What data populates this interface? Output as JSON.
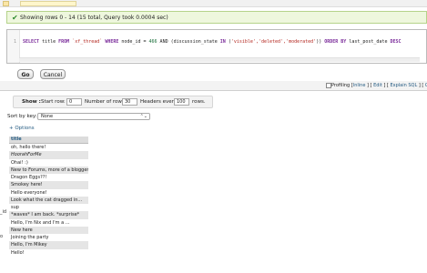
{
  "success": {
    "message": "Showing rows 0 - 14 (15 total, Query took 0.0004 sec)",
    "check_glyph": "✔"
  },
  "sql": {
    "line_number": "1",
    "tokens": {
      "t1": "SELECT",
      "t2": " title ",
      "t3": "FROM",
      "t4": " `xf_thread` ",
      "t5": "WHERE",
      "t6": " node_id = ",
      "t7": "466",
      "t8": " AND (discussion_state ",
      "t9": "IN",
      "t10": " (",
      "t11": "'visible','deleted','moderated'",
      "t12": ")) ",
      "t13": "ORDER BY",
      "t14": " last_post_date ",
      "t15": "DESC"
    }
  },
  "buttons": {
    "go": "Go",
    "cancel": "Cancel"
  },
  "profiling": {
    "label": "Profiling [",
    "inline": "Inline",
    "sep1": " ] [ ",
    "edit": "Edit",
    "sep2": " ] [ ",
    "explain": "Explain SQL",
    "sep3": " ] [ ",
    "create": "Cr"
  },
  "nav": {
    "show_label": "Show :",
    "start_row_label": "Start row:",
    "start_row_value": "0",
    "num_rows_label": "Number of rows:",
    "num_rows_value": "30",
    "headers_every_label": "Headers every",
    "headers_every_value": "100",
    "rows_label": "rows."
  },
  "sort": {
    "label": "Sort by key:",
    "selected": "None",
    "chevron": "⌃⌄"
  },
  "options_link": "+ Options",
  "table": {
    "header": "title",
    "rows": [
      "oh, hello there!",
      "HoorahForMe",
      "Ohai! :)",
      "New to Forums, more of a blogger",
      "Dragon Eggs??!",
      "Smokey here!",
      "Hello everyone!",
      "Look what the cat dragged in...",
      "sup",
      "*waves* I am back. *surprise*",
      "Hello, I'm Nix and I'm a ...",
      "New here",
      "Joining the party",
      "Hello, I'm Mikey",
      "Hello!"
    ]
  },
  "edge_text": {
    "a": "_id",
    "b": "o"
  },
  "colors": {
    "success_bg": "#eef7dd",
    "link": "#235a81",
    "row_alt": "#e5e5e5"
  }
}
